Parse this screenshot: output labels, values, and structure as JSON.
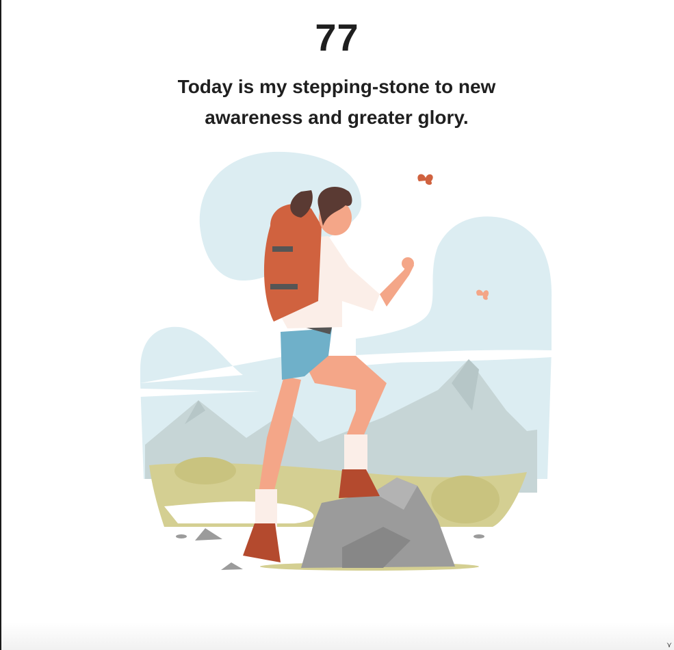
{
  "page": {
    "number": "77",
    "quote": "Today is my stepping-stone to new awareness and greater glory."
  },
  "illustration": {
    "subject": "hiker-woman-climbing-rock",
    "colors": {
      "sky": "#dcedf2",
      "mountain": "#c6d5d6",
      "grass": "#d4cf92",
      "rock": "#9b9b9b",
      "backpack": "#d0623f",
      "skin": "#f4a688",
      "shorts": "#6fb0c9",
      "shirt": "#fbeee8"
    }
  },
  "window": {
    "resize_handle_icon": "resize-handle-icon",
    "resize_glyph": "⋎"
  }
}
